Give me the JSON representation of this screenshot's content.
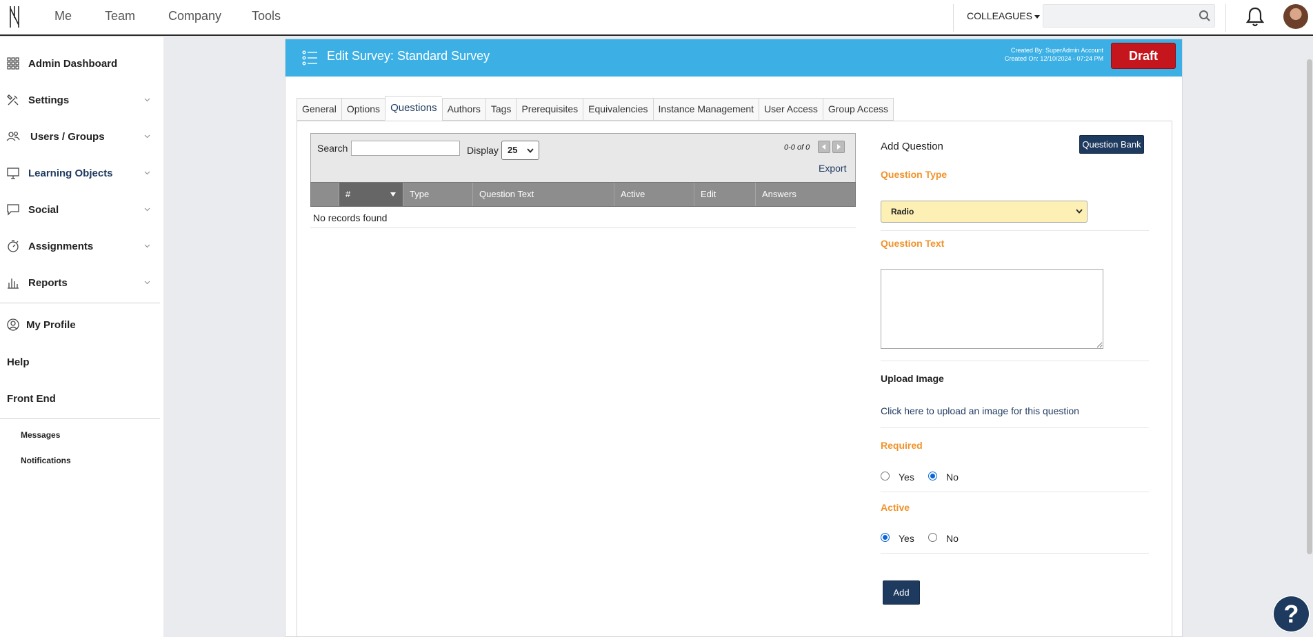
{
  "topbar": {
    "nav": [
      "Me",
      "Team",
      "Company",
      "Tools"
    ],
    "colleagues_label": "COLLEAGUES",
    "search_placeholder": "",
    "icons": {
      "search": "search-icon",
      "bell": "bell-icon",
      "avatar": "avatar"
    }
  },
  "sidebar": {
    "items": [
      {
        "label": "Admin Dashboard",
        "icon": "grid-icon",
        "expandable": false
      },
      {
        "label": "Settings",
        "icon": "tools-icon",
        "expandable": true
      },
      {
        "label": "Users / Groups",
        "icon": "users-icon",
        "expandable": true
      },
      {
        "label": "Learning Objects",
        "icon": "monitor-icon",
        "expandable": true,
        "active": true
      },
      {
        "label": "Social",
        "icon": "chat-icon",
        "expandable": true
      },
      {
        "label": "Assignments",
        "icon": "stopwatch-icon",
        "expandable": true
      },
      {
        "label": "Reports",
        "icon": "bar-chart-icon",
        "expandable": true
      }
    ],
    "profile": "My Profile",
    "help": "Help",
    "front_end": "Front End",
    "sub": [
      "Messages",
      "Notifications"
    ]
  },
  "header": {
    "title": "Edit Survey: Standard Survey",
    "created_by": "Created By: SuperAdmin Account",
    "created_on": "Created On: 12/10/2024 - 07:24 PM",
    "status": "Draft",
    "accent": "#3cb0e5",
    "status_color": "#c4161c"
  },
  "tabs": [
    {
      "label": "General"
    },
    {
      "label": "Options"
    },
    {
      "label": "Questions",
      "active": true
    },
    {
      "label": "Authors"
    },
    {
      "label": "Tags"
    },
    {
      "label": "Prerequisites"
    },
    {
      "label": "Equivalencies"
    },
    {
      "label": "Instance Management"
    },
    {
      "label": "User Access"
    },
    {
      "label": "Group Access"
    }
  ],
  "grid": {
    "search_label": "Search",
    "search_value": "",
    "display_label": "Display",
    "display_value": "25",
    "count": "0-0 of 0",
    "export": "Export",
    "columns": [
      "",
      "#",
      "Type",
      "Question Text",
      "Active",
      "Edit",
      "Answers"
    ],
    "empty": "No records found"
  },
  "form": {
    "title": "Add Question",
    "question_bank": "Question Bank",
    "question_type_label": "Question Type",
    "question_type_value": "Radio",
    "question_text_label": "Question Text",
    "question_text_value": "",
    "upload_label": "Upload Image",
    "upload_link": "Click here to upload an image for this question",
    "required_label": "Required",
    "required": {
      "yes": "Yes",
      "no": "No",
      "selected": "No"
    },
    "active_label": "Active",
    "active": {
      "yes": "Yes",
      "no": "No",
      "selected": "Yes"
    },
    "add": "Add",
    "label_color": "#f0932b"
  },
  "help_button": "?"
}
